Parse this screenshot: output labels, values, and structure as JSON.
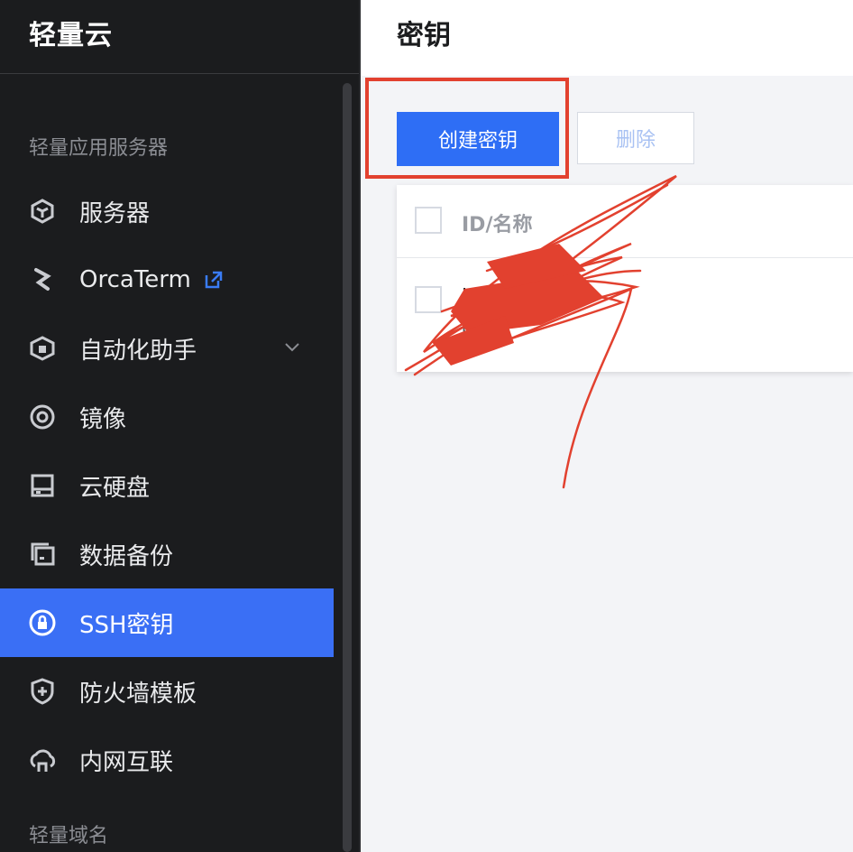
{
  "sidebar": {
    "brand": "轻量云",
    "section1": "轻量应用服务器",
    "items": [
      {
        "label": "服务器",
        "icon": "cube-icon"
      },
      {
        "label": "OrcaTerm",
        "icon": "terminal-icon",
        "external": "external-link-icon"
      },
      {
        "label": "自动化助手",
        "icon": "automation-icon",
        "chevron": "chevron-down-icon"
      },
      {
        "label": "镜像",
        "icon": "image-disc-icon"
      },
      {
        "label": "云硬盘",
        "icon": "disk-icon"
      },
      {
        "label": "数据备份",
        "icon": "backup-icon"
      },
      {
        "label": "SSH密钥",
        "icon": "key-lock-icon",
        "active": true
      },
      {
        "label": "防火墙模板",
        "icon": "shield-icon"
      },
      {
        "label": "内网互联",
        "icon": "cloud-network-icon"
      }
    ],
    "section2": "轻量域名"
  },
  "header": {
    "title": "密钥"
  },
  "toolbar": {
    "create_label": "创建密钥",
    "delete_label": "删除"
  },
  "table": {
    "columns": [
      "ID/名称"
    ],
    "rows": [
      {
        "id_prefix": "l",
        "name_suffix": "dy",
        "sub": "p"
      }
    ]
  },
  "colors": {
    "accent": "#2e6ef5",
    "active_nav": "#3a6ff5",
    "annotation": "#e2412f",
    "sidebar_bg": "#1b1c1e"
  }
}
